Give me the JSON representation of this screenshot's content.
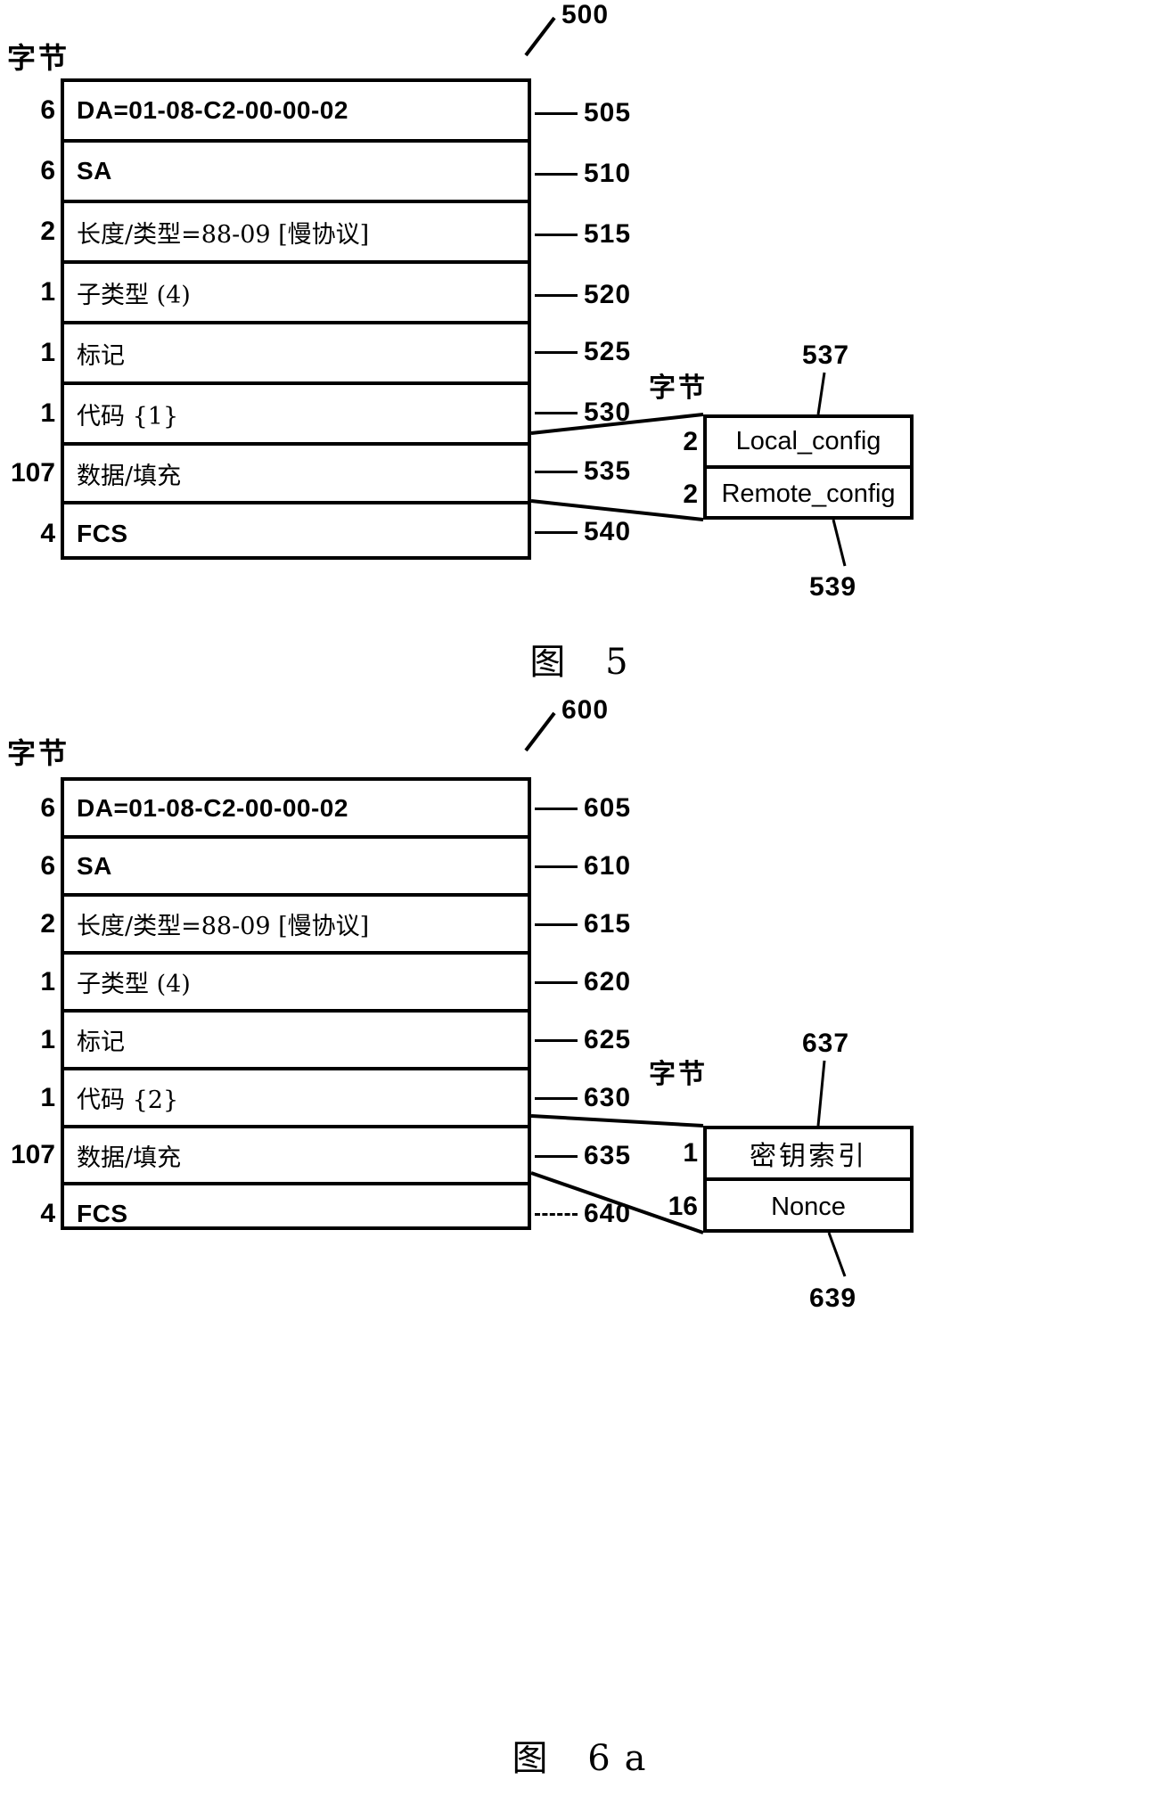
{
  "figures": [
    {
      "id": "fig5",
      "caption": "图 5",
      "diagram_ref": "500",
      "byte_header": "字节",
      "frame_rows": [
        {
          "size": "6",
          "label": "DA=01-08-C2-00-00-02",
          "ref": "505"
        },
        {
          "size": "6",
          "label": "SA",
          "ref": "510"
        },
        {
          "size": "2",
          "label": "长度/类型=88-09 [慢协议]",
          "ref": "515"
        },
        {
          "size": "1",
          "label": "子类型 (4)",
          "ref": "520"
        },
        {
          "size": "1",
          "label": "标记",
          "ref": "525"
        },
        {
          "size": "1",
          "label": "代码 {1}",
          "ref": "530"
        },
        {
          "size": "107",
          "label": "数据/填充",
          "ref": "535"
        },
        {
          "size": "4",
          "label": "FCS",
          "ref": "540"
        }
      ],
      "detail": {
        "byte_header": "字节",
        "ref_top": "537",
        "ref_bottom": "539",
        "rows": [
          {
            "size": "2",
            "label": "Local_config"
          },
          {
            "size": "2",
            "label": "Remote_config"
          }
        ]
      }
    },
    {
      "id": "fig6",
      "caption": "图 6a",
      "diagram_ref": "600",
      "byte_header": "字节",
      "frame_rows": [
        {
          "size": "6",
          "label": "DA=01-08-C2-00-00-02",
          "ref": "605"
        },
        {
          "size": "6",
          "label": "SA",
          "ref": "610"
        },
        {
          "size": "2",
          "label": "长度/类型=88-09 [慢协议]",
          "ref": "615"
        },
        {
          "size": "1",
          "label": "子类型 (4)",
          "ref": "620"
        },
        {
          "size": "1",
          "label": "标记",
          "ref": "625"
        },
        {
          "size": "1",
          "label": "代码 {2}",
          "ref": "630"
        },
        {
          "size": "107",
          "label": "数据/填充",
          "ref": "635"
        },
        {
          "size": "4",
          "label": "FCS",
          "ref": "640"
        }
      ],
      "detail": {
        "byte_header": "字节",
        "ref_top": "637",
        "ref_bottom": "639",
        "rows": [
          {
            "size": "1",
            "label": "密钥索引"
          },
          {
            "size": "16",
            "label": "Nonce"
          }
        ]
      }
    }
  ]
}
